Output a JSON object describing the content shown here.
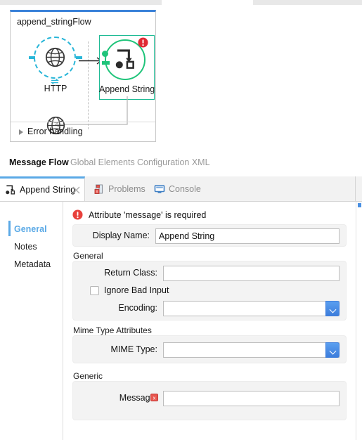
{
  "colors": {
    "selection_blue": "#3b82d9",
    "http_cyan": "#29b6d8",
    "append_green": "#1fc47a",
    "selection_teal": "#1fbb95",
    "error_red": "#e8413c",
    "accent_blue": "#5aa9e6",
    "combo_blue": "#3d7ddc"
  },
  "canvas": {
    "flow_name": "append_stringFlow",
    "nodes": [
      {
        "label": "HTTP",
        "icon": "globe-icon",
        "kind": "http-endpoint"
      },
      {
        "label": "Append String",
        "icon": "transformer-icon",
        "kind": "transformer",
        "selected": true,
        "has_error": true
      }
    ],
    "response_node": {
      "icon": "globe-icon",
      "label": ""
    },
    "error_handling": {
      "label": "Error handling",
      "icon": "chevron-right-icon",
      "expanded": false
    }
  },
  "editor_tabs": [
    {
      "label": "Message Flow",
      "active": true
    },
    {
      "label": "Global Elements",
      "active": false
    },
    {
      "label": "Configuration XML",
      "active": false
    }
  ],
  "view_tabs": [
    {
      "label": "Append String",
      "icon": "transformer-icon",
      "active": true,
      "closable": true,
      "close_icon": "close-icon"
    },
    {
      "label": "Problems",
      "icon": "problems-icon",
      "active": false
    },
    {
      "label": "Console",
      "icon": "console-icon",
      "active": false
    }
  ],
  "properties": {
    "side_nav": [
      {
        "label": "General",
        "active": true
      },
      {
        "label": "Notes",
        "active": false
      },
      {
        "label": "Metadata",
        "active": false
      }
    ],
    "banner": {
      "icon": "error-circle-icon",
      "text": "Attribute 'message' is required"
    },
    "display_name": {
      "label": "Display Name:",
      "value": "Append String",
      "placeholder": ""
    },
    "groups": [
      {
        "title": "General",
        "fields": [
          {
            "type": "text",
            "label": "Return Class:",
            "value": "",
            "placeholder": ""
          },
          {
            "type": "checkbox",
            "label": "Ignore Bad Input",
            "checked": false
          },
          {
            "type": "combo",
            "label": "Encoding:",
            "value": "",
            "placeholder": ""
          }
        ]
      },
      {
        "title": "Mime Type Attributes",
        "fields": [
          {
            "type": "combo",
            "label": "MIME Type:",
            "value": "",
            "placeholder": ""
          }
        ]
      },
      {
        "title": "Generic",
        "fields": [
          {
            "type": "text",
            "label": "Message:",
            "value": "",
            "placeholder": "",
            "error_icon": "error-square-icon"
          }
        ]
      }
    ]
  }
}
